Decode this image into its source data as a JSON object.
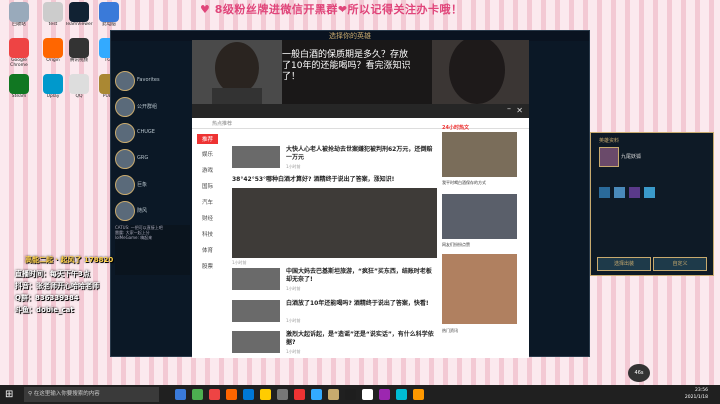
{
  "banner": "♥ 8级粉丝牌进微信开黑群❤所以记得关注办卡哦！",
  "desktop_icons": [
    {
      "label": "回收站",
      "color": "#9ab"
    },
    {
      "label": "test",
      "color": "#ccc"
    },
    {
      "label": "TeamViewer",
      "color": "#123"
    },
    {
      "label": "此电脑",
      "color": "#3a7ad9"
    },
    {
      "label": "Google Chrome",
      "color": "#e44"
    },
    {
      "label": "Origin",
      "color": "#f60"
    },
    {
      "label": "腾讯视频",
      "color": "#333"
    },
    {
      "label": "TGP",
      "color": "#3af"
    },
    {
      "label": "Steam",
      "color": "#172"
    },
    {
      "label": "Uplay",
      "color": "#09c"
    },
    {
      "label": "QQ",
      "color": "#ddd"
    },
    {
      "label": "PUBG",
      "color": "#a83"
    }
  ],
  "game": {
    "title": "选择你的英雄",
    "friends": [
      "Favorites",
      "公开群组",
      "CHUGE",
      "GRG",
      "巨象",
      "随风"
    ]
  },
  "video": {
    "caption": "一般白酒的保质期是多久？存放了10年的还能喝吗？看完涨知识了！"
  },
  "news": {
    "window_title": "热点推荐",
    "menu": [
      "推荐",
      "娱乐",
      "游戏",
      "国际",
      "汽车",
      "财经",
      "科技",
      "体育",
      "股票"
    ],
    "articles": [
      {
        "title": "大快人心老人被抢劫去世案嫌犯被判刑62万元，还倒赔一万元",
        "meta": "1小时前"
      },
      {
        "title": "38°42°53°哪种白酒才算好? 酒精终于说出了答案，涨知识!",
        "meta": "1小时前"
      },
      {
        "title": "中国大妈去巴基斯坦旅游，“疯狂”买东西，结账时老板却无奈了!",
        "meta": "1小时前"
      },
      {
        "title": "白酒放了10年还能喝吗? 酒精终于说出了答案，快看!",
        "meta": "1小时前"
      },
      {
        "title": "激烈大起诉起，是“造谣”还是“说实话”，有什么科学依据?",
        "meta": "1小时前"
      }
    ],
    "sidebar_title": "24小时热文",
    "sidebar_items": [
      "我平时喝白酒保存的方式",
      "网友们纷纷点赞",
      "热门资讯"
    ]
  },
  "panel": {
    "title": "英雄资料",
    "hero": "九尾妖狐",
    "btn_left": "选择出装",
    "btn_right": "自定义"
  },
  "chat": {
    "lines": [
      "CATUS: 一把可以直接上吧",
      "雷霆: 大家一起上分",
      "lolMeGame: 嗨起来"
    ]
  },
  "promo": {
    "line1": "高能二起 · 起风了 178820",
    "line2": "直播时间：每天下午3点",
    "line3": "抖音：张老师开心哈哈老师",
    "line4": "Q群：836339384",
    "line5": "斗鱼：dobie_cat"
  },
  "taskbar": {
    "search_placeholder": "在这里输入你要搜索的内容",
    "time": "23:56",
    "date": "2021/1/18",
    "counter": "46s"
  }
}
